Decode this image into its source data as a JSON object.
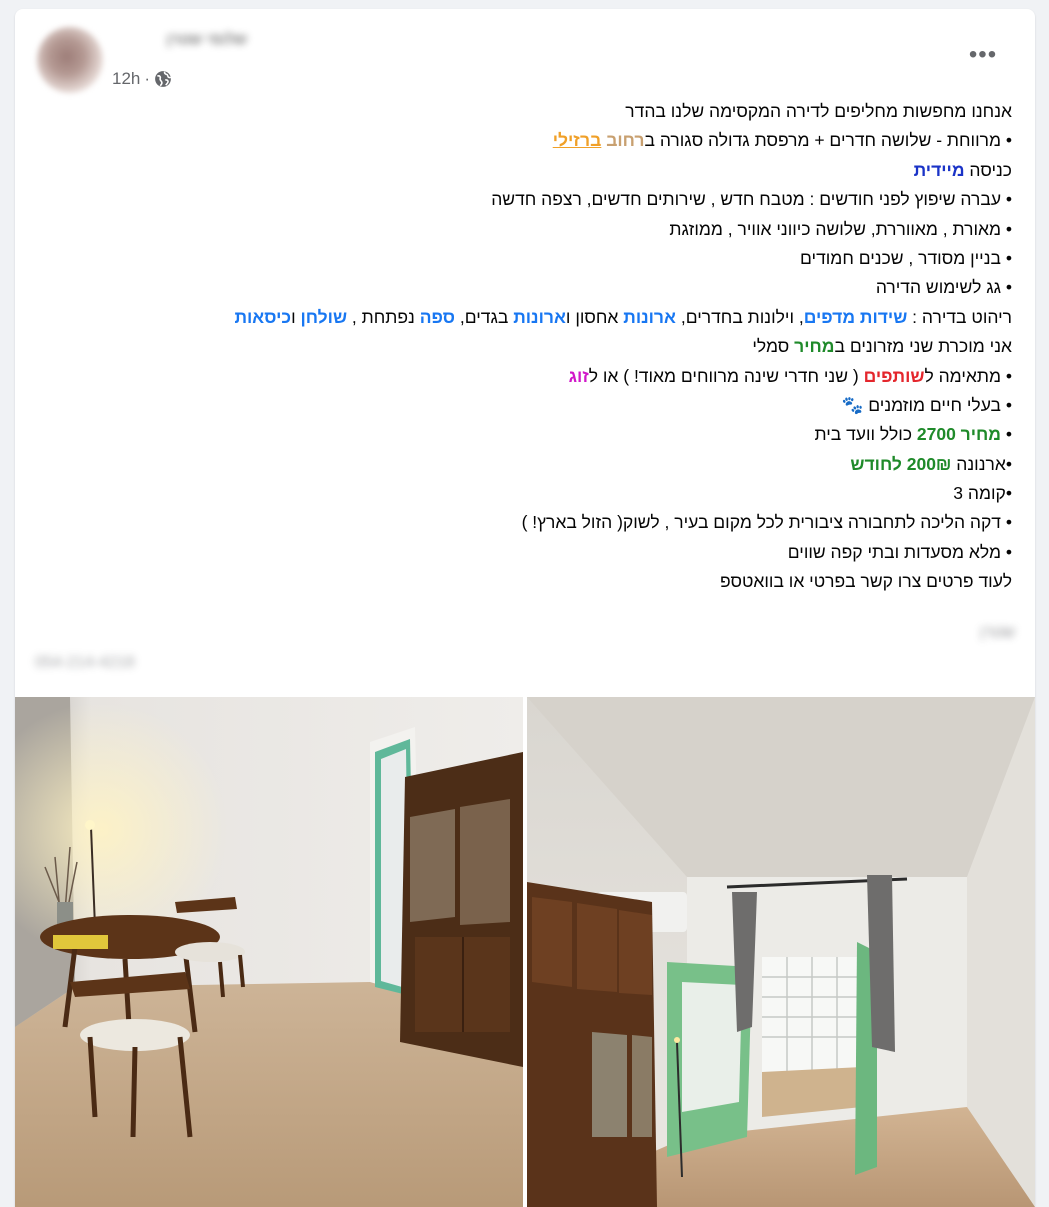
{
  "post": {
    "author": "שלומי שטרן",
    "time": "12h",
    "separator": "·",
    "privacy_icon": "globe-icon",
    "more_label": "•••",
    "footer_name": "שטרן",
    "footer_phone": "054-214-4218"
  },
  "text": {
    "l1": "אנחנו מחפשות מחליפים לדירה המקסימה שלנו בהדר",
    "l2a": "• מרווחת - שלושה חדרים + מרפסת גדולה סגורה ב",
    "l2b": "רחוב",
    "l2c": " ",
    "l2d": "ברזילי",
    "l3a": "כניסה ",
    "l3b": " מיידית",
    "l4": "• עברה שיפוץ לפני חודשים : מטבח חדש , שירותים חדשים, רצפה חדשה",
    "l5": "• מאורת , מאווררת, שלושה כיווני אוויר , ממוזגת",
    "l6": "• בניין מסודר , שכנים חמודים",
    "l7": "• גג לשימוש הדירה",
    "l8a": "ריהוט בדירה : ",
    "l8b": "שידות מדפים",
    "l8c": ", וילונות בחדרים, ",
    "l8d": "ארונות",
    "l8e": " אחסון ו",
    "l8f": "ארונות",
    "l8g": " בגדים, ",
    "l8h": "ספה",
    "l8i": " נפתחת , ",
    "l8j": "שולחן",
    "l8k": " ו",
    "l8l": "כיסאות",
    "l9a": "אני מוכרת שני מזרונים ב",
    "l9b": "מחיר",
    "l9c": " סמלי",
    "l10a": "• מתאימה ל",
    "l10b": "שותפים",
    "l10c": " ( שני חדרי שינה מרווחים מאוד! ) או ל",
    "l10d": "זוג",
    "l11a": "• בעלי חיים מוזמנים ",
    "l11b": "🐾",
    "l12a": "• ",
    "l12b": "מחיר 2700",
    "l12c": " כולל וועד בית",
    "l13a": "•ארנונה ",
    "l13b": "200₪ לחודש",
    "l14": "•קומה 3",
    "l15": "• דקה הליכה לתחבורה ציבורית לכל מקום בעיר , לשוק( הזול בארץ! )",
    "l16": "• מלא מסעדות ובתי קפה שווים",
    "l17": "לעוד פרטים צרו קשר בפרטי או בוואטספ"
  },
  "colors": {
    "link_blue": "#1877f2",
    "accent_green": "#1f8a2a",
    "accent_red": "#e4262c",
    "accent_pink": "#d118c9",
    "accent_orange": "#f0a028",
    "meta_gray": "#65676b"
  },
  "photos": [
    {
      "name": "dining-room-photo"
    },
    {
      "name": "bedroom-photo"
    }
  ]
}
